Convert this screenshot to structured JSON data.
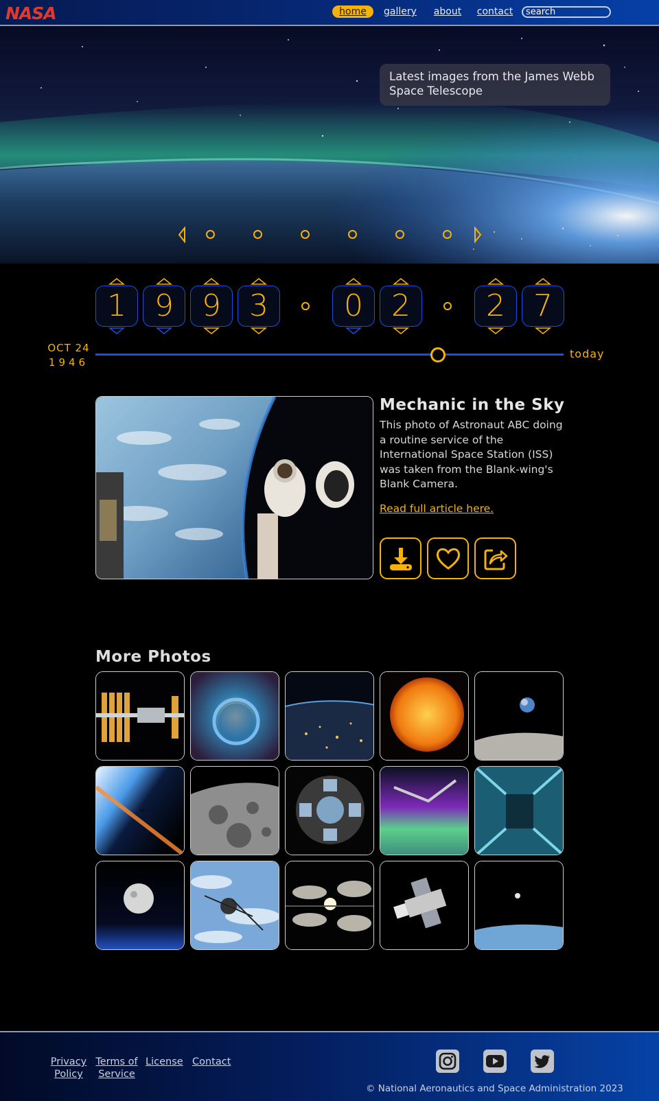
{
  "header": {
    "logo_text": "NASA",
    "nav": [
      {
        "label": "home",
        "active": true
      },
      {
        "label": "gallery",
        "active": false
      },
      {
        "label": "about",
        "active": false
      },
      {
        "label": "contact",
        "active": false
      }
    ],
    "search_placeholder": "search"
  },
  "hero": {
    "caption": "Latest images from the James Webb Space Telescope",
    "slides": 6,
    "active_slide": 0
  },
  "date_picker": {
    "year_digits": [
      "1",
      "9",
      "9",
      "3"
    ],
    "month_digits": [
      "0",
      "2"
    ],
    "day_digits": [
      "2",
      "7"
    ],
    "range_start_month": "OCT 24",
    "range_start_year": "1946",
    "range_end": "today",
    "slider_position_fraction": 0.73
  },
  "feature": {
    "title": "Mechanic in the Sky",
    "description": "This photo of Astronaut ABC doing a routine service of the International Space Station (ISS) was taken from the Blank-wing's Blank Camera.",
    "link_text": "Read full article here.",
    "actions": [
      "download-icon",
      "heart-icon",
      "share-icon"
    ]
  },
  "more_photos": {
    "title": "More Photos",
    "thumbnails": [
      "space-station",
      "bubble-nebula",
      "earth-night-lights",
      "sun",
      "earthrise",
      "space-shuttle-horizon",
      "moon-surface",
      "cupola-window",
      "aurora-station",
      "station-interior",
      "moon",
      "spacecraft-over-earth",
      "rocket-launch",
      "hubble-telescope",
      "astronaut-floating"
    ]
  },
  "footer": {
    "links": [
      {
        "line1": "Privacy",
        "line2": "Policy"
      },
      {
        "line1": "Terms of",
        "line2": "Service"
      },
      {
        "line1": "License",
        "line2": ""
      },
      {
        "line1": "Contact",
        "line2": ""
      }
    ],
    "social": [
      "instagram-icon",
      "youtube-icon",
      "twitter-icon"
    ],
    "copyright": "© National Aeronautics and Space Administration 2023"
  },
  "colors": {
    "accent": "#f4b20b",
    "blue": "#1d4fd8",
    "logo_red": "#e03a2e"
  }
}
